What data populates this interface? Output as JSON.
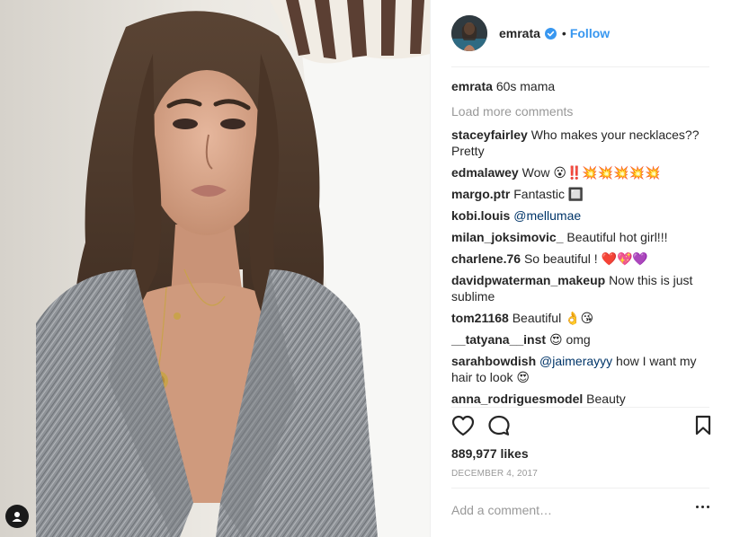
{
  "header": {
    "username": "emrata",
    "dot": "•",
    "follow_label": "Follow"
  },
  "caption": {
    "username": "emrata",
    "text": "60s mama"
  },
  "load_more_label": "Load more comments",
  "comments": [
    {
      "username": "staceyfairley",
      "text": "Who makes your necklaces?? Pretty"
    },
    {
      "username": "edmalawey",
      "text": "Wow 😮‼️💥💥💥💥💥"
    },
    {
      "username": "margo.ptr",
      "text": "Fantastic 🔲"
    },
    {
      "username": "kobi.louis",
      "mention": "@mellumae",
      "text": ""
    },
    {
      "username": "milan_joksimovic_",
      "text": "Beautiful hot girl!!!"
    },
    {
      "username": "charlene.76",
      "text": "So beautiful ! ❤️💖💜"
    },
    {
      "username": "davidpwaterman_makeup",
      "text": "Now this is just sublime"
    },
    {
      "username": "tom21168",
      "text": "Beautiful 👌😘"
    },
    {
      "username": "__tatyana__inst",
      "text": "😍 omg"
    },
    {
      "username": "sarahbowdish",
      "mention": "@jaimerayyy",
      "text": "how I want my hair to look 😍"
    },
    {
      "username": "anna_rodriguesmodel",
      "text": "Beauty"
    }
  ],
  "likes": "889,977 likes",
  "date": "DECEMBER 4, 2017",
  "add_comment": {
    "placeholder": "Add a comment…"
  },
  "icons": {
    "like": "heart-icon",
    "comment": "comment-bubble-icon",
    "save": "bookmark-icon",
    "verified": "verified-badge-icon",
    "more": "more-options-icon",
    "tagged": "tagged-user-icon"
  },
  "colors": {
    "link_blue": "#3897f0",
    "mention_blue": "#003569",
    "muted_gray": "#999999",
    "text": "#262626",
    "divider": "#efefef"
  }
}
